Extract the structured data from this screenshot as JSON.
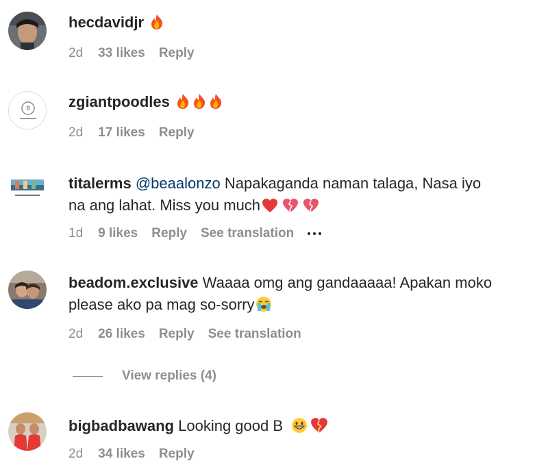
{
  "comments": [
    {
      "username": "hecdavidjr",
      "text": "",
      "emojis": [
        "fire-emoji"
      ],
      "time": "2d",
      "likes": "33 likes",
      "reply": "Reply"
    },
    {
      "username": "zgiantpoodles",
      "text": "",
      "emojis": [
        "fire-emoji",
        "fire-emoji",
        "fire-emoji"
      ],
      "time": "2d",
      "likes": "17 likes",
      "reply": "Reply"
    },
    {
      "username": "titalerms",
      "mention": "@beaalonzo",
      "text_line1": "Napakaganda naman talaga, Nasa iyo",
      "text_line2": "na ang lahat. Miss you much",
      "emojis": [
        "red-heart-emoji",
        "broken-heart-emoji",
        "broken-heart-emoji"
      ],
      "time": "1d",
      "likes": "9 likes",
      "reply": "Reply",
      "translation": "See translation"
    },
    {
      "username": "beadom.exclusive",
      "text_line1": "Waaaa omg ang gandaaaaa! Apakan moko",
      "text_line2": "please ako pa mag so-sorry",
      "emojis": [
        "crying-face-emoji"
      ],
      "time": "2d",
      "likes": "26 likes",
      "reply": "Reply",
      "translation": "See translation",
      "view_replies": "View replies (4)"
    },
    {
      "username": "bigbadbawang",
      "text": "Looking good B",
      "emojis": [
        "grinning-face-emoji",
        "broken-heart-emoji"
      ],
      "time": "2d",
      "likes": "34 likes",
      "reply": "Reply"
    }
  ]
}
